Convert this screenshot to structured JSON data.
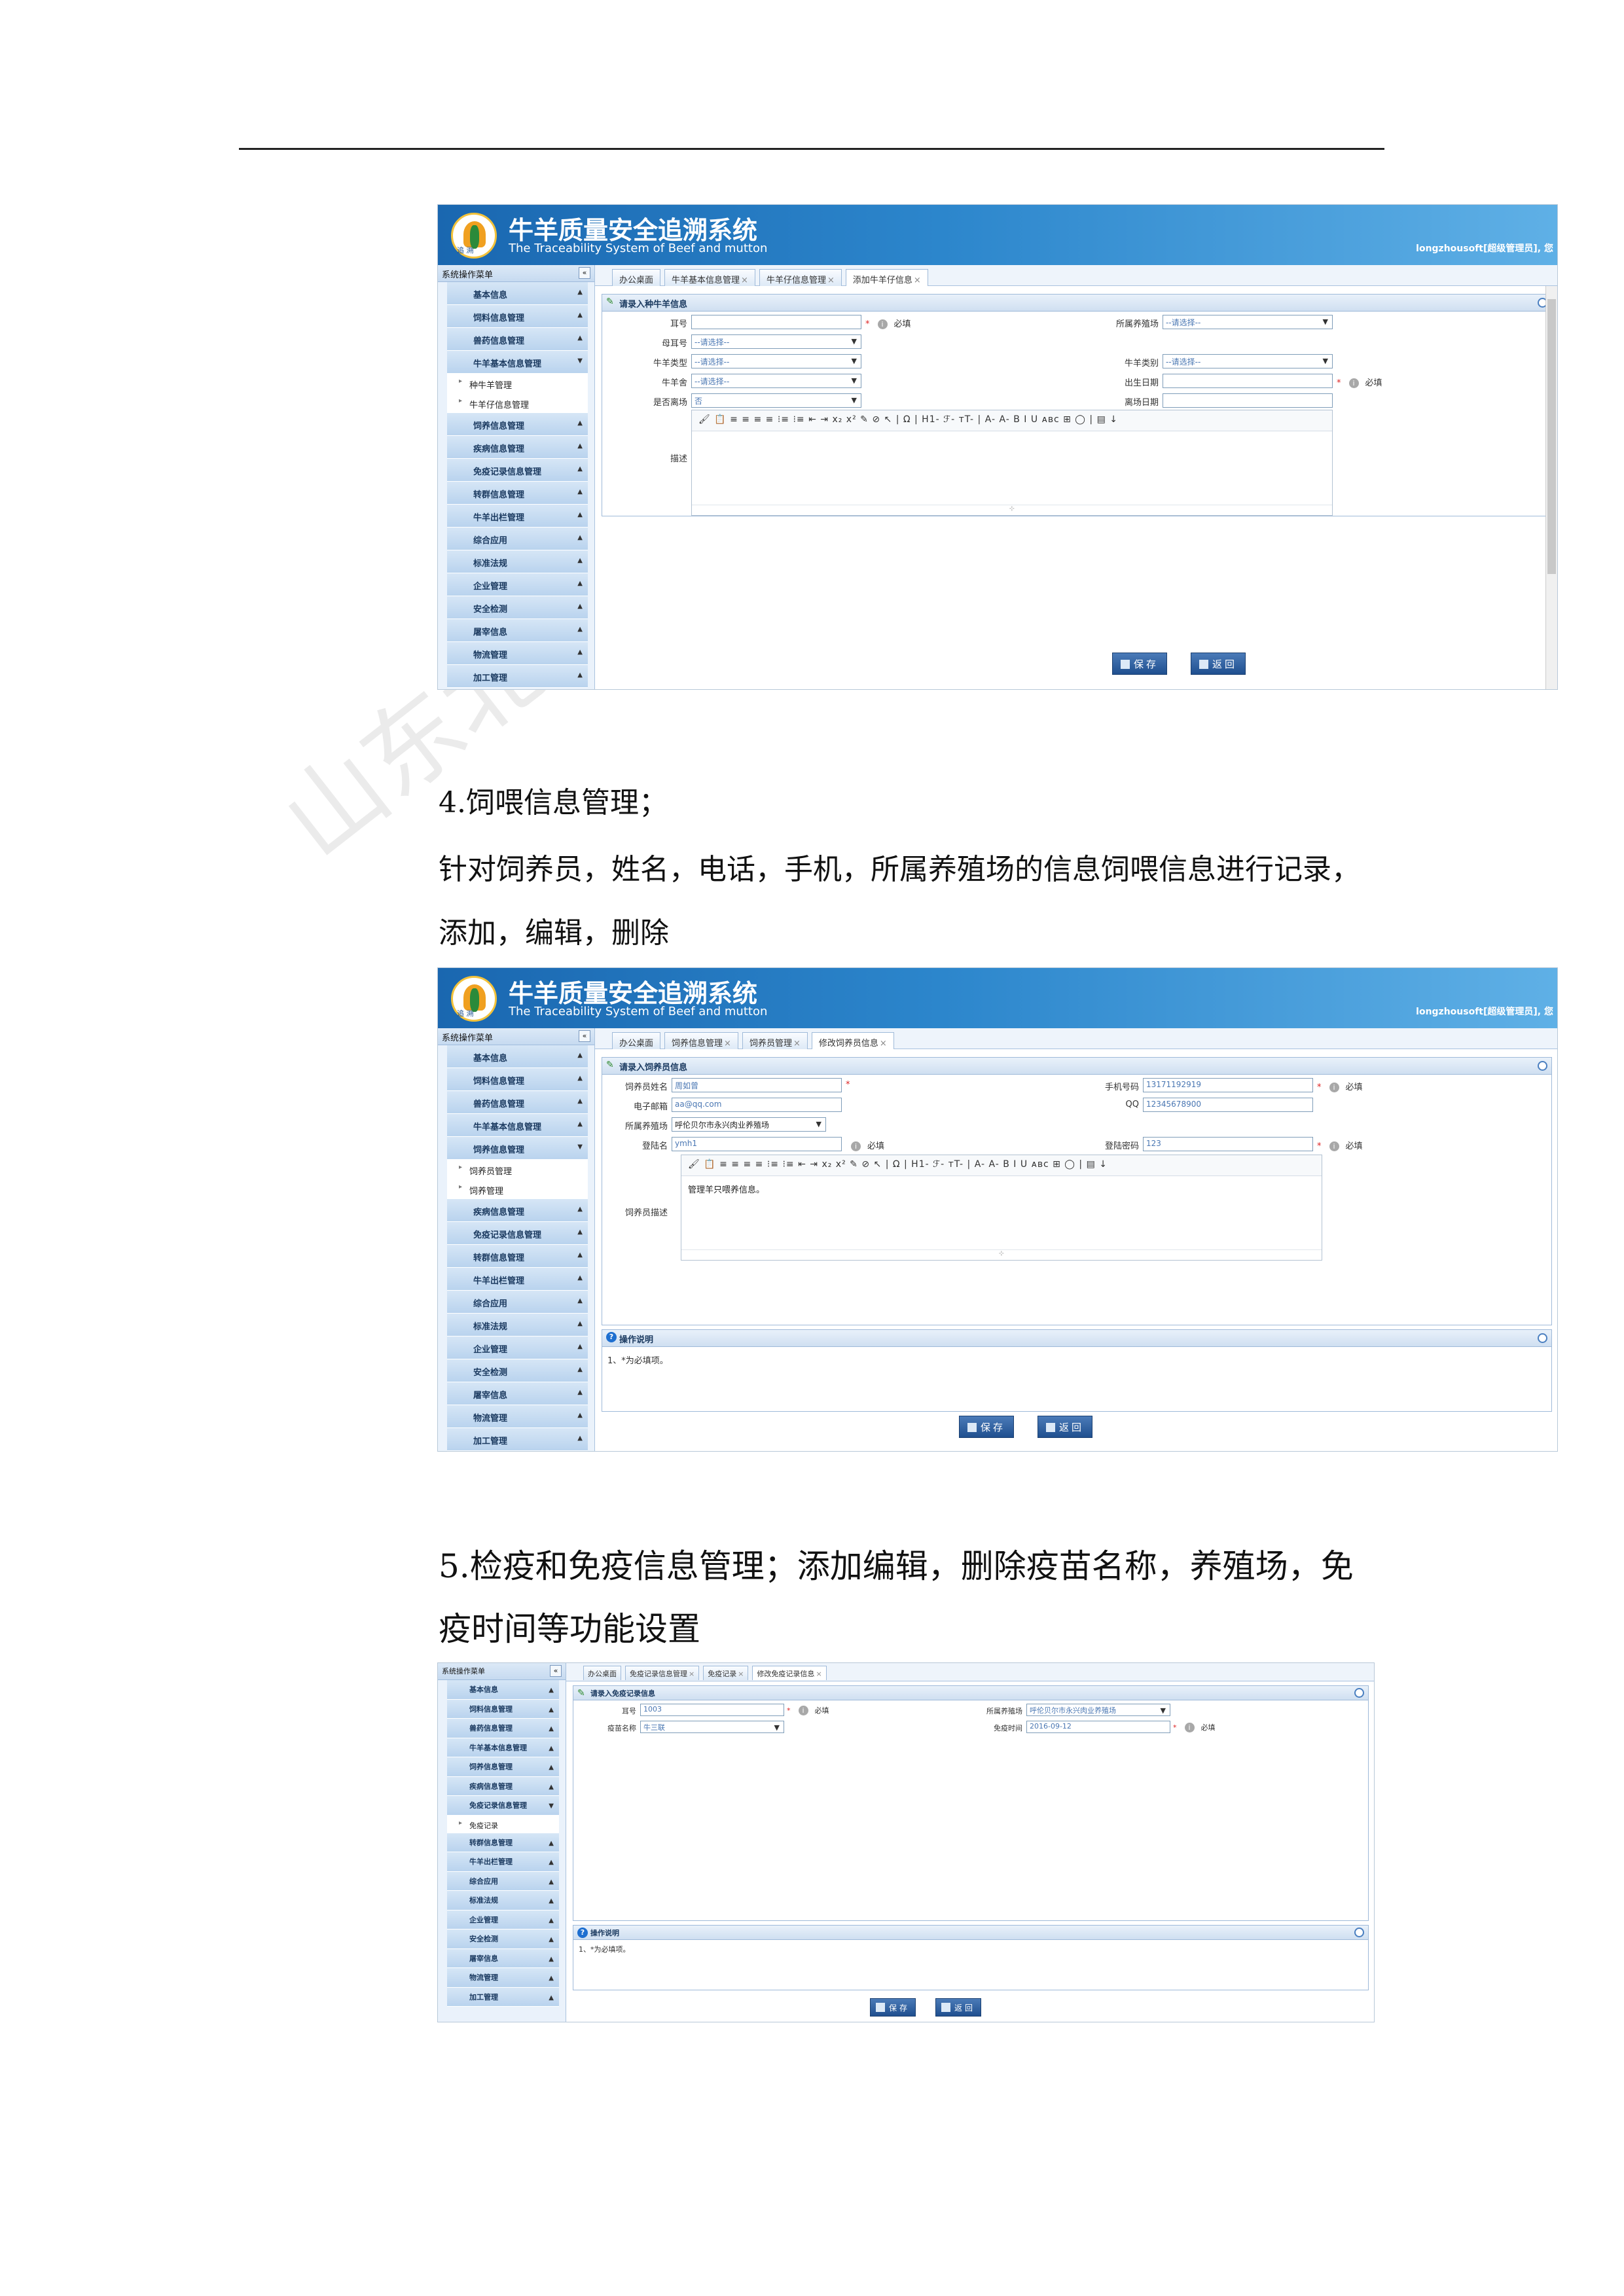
{
  "section4": {
    "heading": "4.饲喂信息管理；",
    "text": "针对饲养员，姓名，电话，手机，所属养殖场的信息饲喂信息进行记录，添加，编辑，删除"
  },
  "section5": {
    "heading": "5.检疫和免疫信息管理；添加编辑，删除疫苗名称，养殖场，免疫时间等功能设置"
  },
  "watermark": "山东北…份有限公…",
  "app": {
    "title": "牛羊质量安全追溯系统",
    "subtitle": "The Traceability System of Beef and mutton",
    "logo_text": "追 溯",
    "user": "longzhousoft[超级管理员], 您"
  },
  "sidebar_title": "系统操作菜单",
  "collapse_glyph": "«",
  "arrow_up": "▲",
  "arrow_down": "▼",
  "shot1": {
    "menu_top": [
      "基本信息",
      "饲料信息管理",
      "兽药信息管理",
      "牛羊基本信息管理"
    ],
    "menu_sub": [
      "种牛羊管理",
      "牛羊仔信息管理"
    ],
    "menu_bottom": [
      "饲养信息管理",
      "疾病信息管理",
      "免疫记录信息管理",
      "转群信息管理",
      "牛羊出栏管理",
      "综合应用",
      "标准法规",
      "企业管理",
      "安全检测",
      "屠宰信息",
      "物流管理",
      "加工管理"
    ],
    "tabs": [
      "办公桌面",
      "牛羊基本信息管理",
      "牛羊仔信息管理",
      "添加牛羊仔信息"
    ],
    "panel_title": "请录入种牛羊信息",
    "labels": [
      "耳号",
      "母耳号",
      "牛羊类型",
      "牛羊舍",
      "是否离场",
      "所属养殖场",
      "牛羊类别",
      "出生日期",
      "离场日期",
      "描述"
    ],
    "select_placeholder": "--请选择--",
    "leave_value": "否",
    "required": "必填",
    "toolbar": "🖌 📋 ≡ ≡ ≡ ≡ ⁝≡ ⁝≡ ⇤ ⇥ x₂ x² ✎ ⊘ ↖ | Ω | H1- ℱ- ᴛT- | A- A- B I U ᴀʙᴄ ⊞ ◯ | ▤ ↓"
  },
  "shot2": {
    "menu_top": [
      "基本信息",
      "饲料信息管理",
      "兽药信息管理",
      "牛羊基本信息管理",
      "饲养信息管理"
    ],
    "menu_sub": [
      "饲养员管理",
      "饲养管理"
    ],
    "menu_bottom": [
      "疾病信息管理",
      "免疫记录信息管理",
      "转群信息管理",
      "牛羊出栏管理",
      "综合应用",
      "标准法规",
      "企业管理",
      "安全检测",
      "屠宰信息",
      "物流管理",
      "加工管理"
    ],
    "tabs": [
      "办公桌面",
      "饲养信息管理",
      "饲养员管理",
      "修改饲养员信息"
    ],
    "panel_title": "请录入饲养员信息",
    "labels": [
      "饲养员姓名",
      "电子邮箱",
      "所属养殖场",
      "登陆名",
      "饲养员描述",
      "手机号码",
      "QQ",
      "登陆密码"
    ],
    "values": {
      "name": "周如曾",
      "email": "aa@qq.com",
      "farm": "呼伦贝尔市永兴肉业养殖场",
      "login": "ymh1",
      "phone": "13171192919",
      "qq": "12345678900",
      "password": "123"
    },
    "description": "管理羊只喂养信息。",
    "note_title": "操作说明",
    "note_text": "1、*为必填项。",
    "required": "必填"
  },
  "shot3": {
    "menu_top": [
      "基本信息",
      "饲料信息管理",
      "兽药信息管理",
      "牛羊基本信息管理",
      "饲养信息管理",
      "疾病信息管理",
      "免疫记录信息管理"
    ],
    "menu_sub": [
      "免疫记录"
    ],
    "menu_bottom": [
      "转群信息管理",
      "牛羊出栏管理",
      "综合应用",
      "标准法规",
      "企业管理",
      "安全检测",
      "屠宰信息",
      "物流管理",
      "加工管理"
    ],
    "tabs": [
      "办公桌面",
      "免疫记录信息管理",
      "免疫记录",
      "修改免疫记录信息"
    ],
    "panel_title": "请录入免疫记录信息",
    "labels": [
      "耳号",
      "疫苗名称",
      "所属养殖场",
      "免疫时间"
    ],
    "values": {
      "ear": "1003",
      "vaccine": "牛三联",
      "farm": "呼伦贝尔市永兴肉业养殖场",
      "date": "2016-09-12"
    },
    "note_title": "操作说明",
    "note_text": "1、*为必填项。",
    "required": "必填"
  },
  "buttons": {
    "save": "保存",
    "back": "返回"
  },
  "tab_close": "×",
  "editor_resize": "⊹",
  "pen_icon": "✎",
  "q_icon": "?",
  "info_icon": "i",
  "star": "*"
}
